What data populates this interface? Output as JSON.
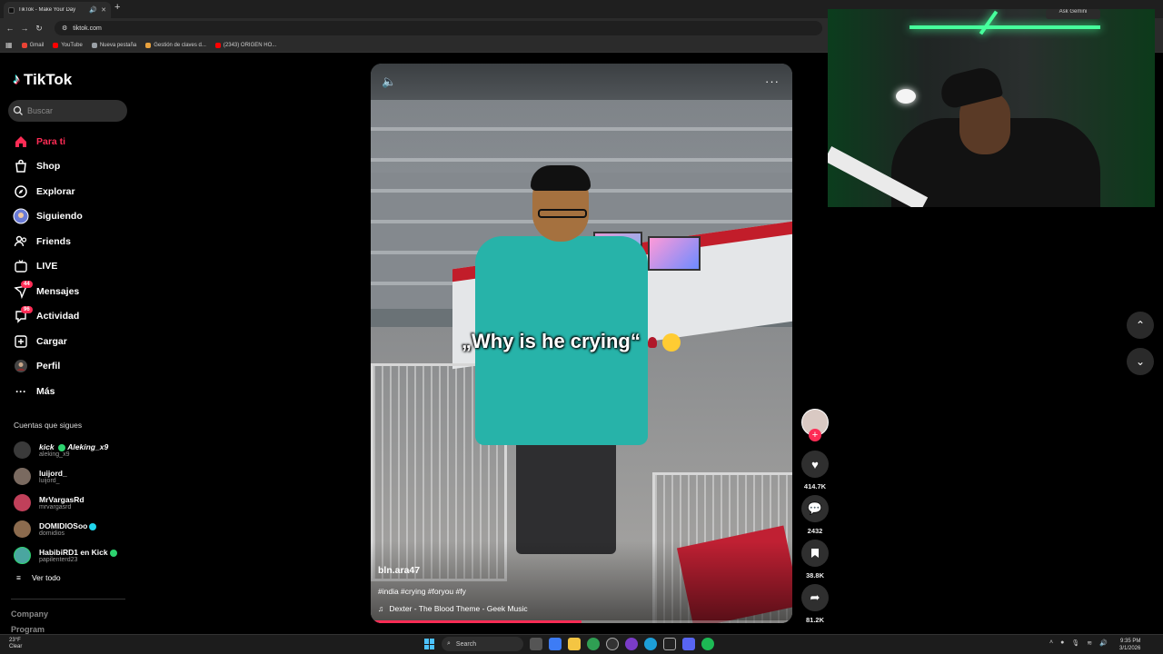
{
  "browser": {
    "tab_title": "TikTok - Make Your Day",
    "url": "tiktok.com",
    "bookmarks": [
      "Gmail",
      "YouTube",
      "Nueva pestaña",
      "Gestión de claves d...",
      "(2343) ORIGEN HO..."
    ],
    "bookmark_colors": [
      "#ea4335",
      "#ff0000",
      "#9aa0a6",
      "#e8a13d",
      "#ff0000"
    ]
  },
  "sidebar": {
    "logo": "TikTok",
    "search_placeholder": "Buscar",
    "nav": [
      {
        "label": "Para ti",
        "icon": "home-icon",
        "active": true
      },
      {
        "label": "Shop",
        "icon": "shop-icon"
      },
      {
        "label": "Explorar",
        "icon": "compass-icon"
      },
      {
        "label": "Siguiendo",
        "icon": "following-avatar-icon"
      },
      {
        "label": "Friends",
        "icon": "friends-icon"
      },
      {
        "label": "LIVE",
        "icon": "live-icon"
      },
      {
        "label": "Mensajes",
        "icon": "messages-icon",
        "badge": "44"
      },
      {
        "label": "Actividad",
        "icon": "activity-icon",
        "badge": "96"
      },
      {
        "label": "Cargar",
        "icon": "upload-icon"
      },
      {
        "label": "Perfil",
        "icon": "profile-icon"
      },
      {
        "label": "Más",
        "icon": "more-icon"
      }
    ],
    "following_title": "Cuentas que sigues",
    "following": [
      {
        "name": "kick",
        "name2": "Aleking_x9",
        "handle": "aleking_x9"
      },
      {
        "name": "luijord_",
        "handle": "luijord_"
      },
      {
        "name": "MrVargasRd",
        "handle": "mrvargasrd"
      },
      {
        "name": "DOMIDIOSoo",
        "handle": "domidios"
      },
      {
        "name": "HabibiRD1 en Kick",
        "handle": "papilenterd23"
      }
    ],
    "see_all": "Ver todo",
    "company": "Company",
    "program": "Program"
  },
  "video": {
    "caption": "„Why is he crying“",
    "author": "bln.ara47",
    "tags": "#india #crying #foryou #fy",
    "music": "Dexter - The Blood Theme - Geek Music",
    "progress": 0.5
  },
  "actions": {
    "likes": "414.7K",
    "comments": "2432",
    "saves": "38.8K",
    "shares": "81.2K"
  },
  "webcam": {
    "overlay_button": "Ask Gemini"
  },
  "taskbar": {
    "weather_temp": "23°F",
    "weather_desc": "Clear",
    "search": "Search",
    "time": "9:35 PM",
    "date": "3/1/2026"
  }
}
